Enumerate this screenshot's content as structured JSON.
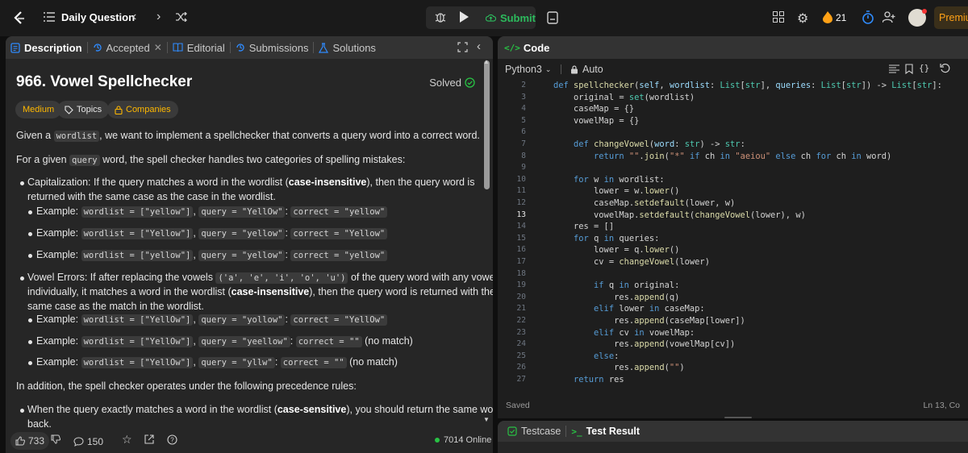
{
  "topbar": {
    "title": "Daily Question",
    "submit_label": "Submit",
    "streak_count": "21",
    "premium_label": "Premiu"
  },
  "left_tabs": {
    "description": "Description",
    "accepted": "Accepted",
    "editorial": "Editorial",
    "submissions": "Submissions",
    "solutions": "Solutions"
  },
  "problem": {
    "title": "966. Vowel Spellchecker",
    "status": "Solved",
    "difficulty": "Medium",
    "topics_label": "Topics",
    "companies_label": "Companies"
  },
  "description": {
    "p1_a": "Given a ",
    "p1_code": "wordlist",
    "p1_b": ", we want to implement a spellchecker that converts a query word into a correct word.",
    "p2_a": "For a given ",
    "p2_code": "query",
    "p2_b": " word, the spell checker handles two categories of spelling mistakes:",
    "cap_line1_a": "Capitalization: If the query matches a word in the wordlist (",
    "cap_line1_bold": "case-insensitive",
    "cap_line1_b": "), then the query word is",
    "cap_line2": "returned with the same case as the case in the wordlist.",
    "example_label": "Example:",
    "ex1": [
      "wordlist = [\"yellow\"]",
      "query = \"YellOw\"",
      "correct = \"yellow\""
    ],
    "ex2": [
      "wordlist = [\"Yellow\"]",
      "query = \"yellow\"",
      "correct = \"Yellow\""
    ],
    "ex3": [
      "wordlist = [\"yellow\"]",
      "query = \"yellow\"",
      "correct = \"yellow\""
    ],
    "vow_line1_a": "Vowel Errors: If after replacing the vowels ",
    "vow_line1_code": "('a', 'e', 'i', 'o', 'u')",
    "vow_line1_b": " of the query word with any vowel",
    "vow_line2_a": "individually, it matches a word in the wordlist (",
    "vow_line2_bold": "case-insensitive",
    "vow_line2_b": "), then the query word is returned with the",
    "vow_line3": "same case as the match in the wordlist.",
    "ex4": [
      "wordlist = [\"YellOw\"]",
      "query = \"yollow\"",
      "correct = \"YellOw\""
    ],
    "ex5": [
      "wordlist = [\"YellOw\"]",
      "query = \"yeellow\"",
      "correct = \"\""
    ],
    "ex6": [
      "wordlist = [\"YellOw\"]",
      "query = \"yllw\"",
      "correct = \"\""
    ],
    "no_match": "(no match)",
    "p3": "In addition, the spell checker operates under the following precedence rules:",
    "rule1_a": "When the query exactly matches a word in the wordlist (",
    "rule1_bold": "case-sensitive",
    "rule1_b": "), you should return the same word",
    "rule1_c": "back."
  },
  "footer": {
    "likes": "733",
    "comments": "150",
    "online": "7014 Online"
  },
  "code_panel": {
    "title": "Code",
    "language": "Python3",
    "mode": "Auto",
    "saved": "Saved",
    "cursor": "Ln 13, Co"
  },
  "code_lines": [
    {
      "n": "2",
      "html": "<span class=\"kw\">def</span> <span class=\"fn\">spellchecker</span>(<span class=\"par\">self</span>, <span class=\"par\">wordlist</span>: <span class=\"cls\">List</span>[<span class=\"cls\">str</span>], <span class=\"par\">queries</span>: <span class=\"cls\">List</span>[<span class=\"cls\">str</span>]) -> <span class=\"cls\">List</span>[<span class=\"cls\">str</span>]:"
    },
    {
      "n": "3",
      "html": "    original = <span class=\"cls\">set</span>(wordlist)"
    },
    {
      "n": "4",
      "html": "    caseMap = {}"
    },
    {
      "n": "5",
      "html": "    vowelMap = {}"
    },
    {
      "n": "6",
      "html": ""
    },
    {
      "n": "7",
      "html": "    <span class=\"kw\">def</span> <span class=\"fn\">changeVowel</span>(<span class=\"par\">word</span>: <span class=\"cls\">str</span>) -> <span class=\"cls\">str</span>:"
    },
    {
      "n": "8",
      "html": "        <span class=\"kw\">return</span> <span class=\"str\">\"\"</span>.<span class=\"fn\">join</span>(<span class=\"str\">\"*\"</span> <span class=\"kw\">if</span> ch <span class=\"kw\">in</span> <span class=\"str\">\"aeiou\"</span> <span class=\"kw\">else</span> ch <span class=\"kw\">for</span> ch <span class=\"kw\">in</span> word)"
    },
    {
      "n": "9",
      "html": ""
    },
    {
      "n": "10",
      "html": "    <span class=\"kw\">for</span> w <span class=\"kw\">in</span> wordlist:"
    },
    {
      "n": "11",
      "html": "        lower = w.<span class=\"fn\">lower</span>()"
    },
    {
      "n": "12",
      "html": "        caseMap.<span class=\"fn\">setdefault</span>(lower, w)"
    },
    {
      "n": "13",
      "html": "        vowelMap.<span class=\"fn\">setdefault</span>(<span class=\"fn\">changeVowel</span>(lower), w)"
    },
    {
      "n": "14",
      "html": "    res = []"
    },
    {
      "n": "15",
      "html": "    <span class=\"kw\">for</span> q <span class=\"kw\">in</span> queries:"
    },
    {
      "n": "16",
      "html": "        lower = q.<span class=\"fn\">lower</span>()"
    },
    {
      "n": "17",
      "html": "        cv = <span class=\"fn\">changeVowel</span>(lower)"
    },
    {
      "n": "18",
      "html": ""
    },
    {
      "n": "19",
      "html": "        <span class=\"kw\">if</span> q <span class=\"kw\">in</span> original:"
    },
    {
      "n": "20",
      "html": "            res.<span class=\"fn\">append</span>(q)"
    },
    {
      "n": "21",
      "html": "        <span class=\"kw\">elif</span> lower <span class=\"kw\">in</span> caseMap:"
    },
    {
      "n": "22",
      "html": "            res.<span class=\"fn\">append</span>(caseMap[lower])"
    },
    {
      "n": "23",
      "html": "        <span class=\"kw\">elif</span> cv <span class=\"kw\">in</span> vowelMap:"
    },
    {
      "n": "24",
      "html": "            res.<span class=\"fn\">append</span>(vowelMap[cv])"
    },
    {
      "n": "25",
      "html": "        <span class=\"kw\">else</span>:"
    },
    {
      "n": "26",
      "html": "            res.<span class=\"fn\">append</span>(<span class=\"str\">\"\"</span>)"
    },
    {
      "n": "27",
      "html": "    <span class=\"kw\">return</span> res"
    }
  ],
  "bottom_panel": {
    "testcase": "Testcase",
    "test_result": "Test Result"
  },
  "colors": {
    "accent_green": "#28c244",
    "accent_blue": "#2f8bff",
    "medium_yellow": "#ffb800",
    "submit_green": "#2cbb5d",
    "streak_orange": "#ffa116"
  },
  "icons": [
    "logo-icon",
    "list-icon",
    "chevron-left-icon",
    "chevron-right-icon",
    "shuffle-icon",
    "bug-icon",
    "play-icon",
    "cloud-upload-icon",
    "note-icon",
    "grid-icon",
    "gear-icon",
    "fire-icon",
    "timer-icon",
    "add-user-icon",
    "avatar",
    "description-icon",
    "history-icon",
    "close-icon",
    "book-icon",
    "flask-icon",
    "expand-icon",
    "code-icon",
    "lock-icon",
    "list-indent-icon",
    "bookmark-icon",
    "braces-icon",
    "reset-icon",
    "thumb-up-icon",
    "thumb-down-icon",
    "comment-icon",
    "star-icon",
    "share-icon",
    "help-icon",
    "check-square-icon",
    "terminal-icon",
    "check-circle-icon",
    "tag-icon"
  ]
}
